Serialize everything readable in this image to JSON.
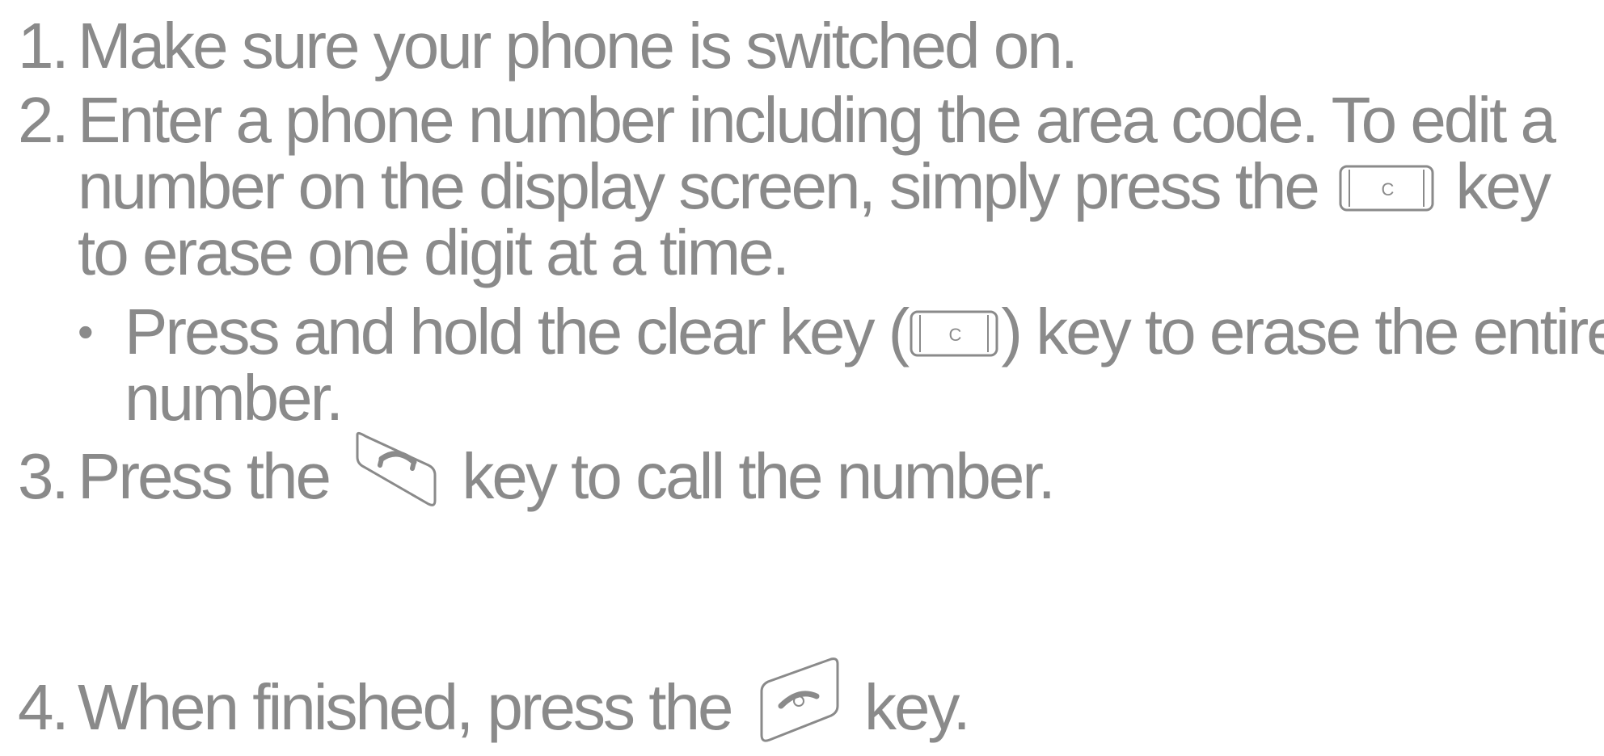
{
  "steps": [
    {
      "number": "1.",
      "lines": [
        "Make sure your phone is switched on."
      ]
    },
    {
      "number": "2.",
      "line1": "Enter a phone number including the area code. To edit a",
      "line2_before": "number on the display screen, simply press the",
      "line2_after": "key",
      "line3": "to erase one digit at a time.",
      "sub": {
        "bullet": "•",
        "line1_before": "Press and hold the clear key (",
        "line1_after": ") key to erase the entire",
        "line2": "number."
      }
    },
    {
      "number": "3.",
      "before": "Press the",
      "after": "key to call the number."
    },
    {
      "number": "4.",
      "before": "When finished, press the",
      "after": "key."
    }
  ],
  "icons": {
    "clear_key_label": "C",
    "clear_key": "clear-key-icon",
    "send_key": "send-key-icon",
    "end_key": "end-key-icon"
  },
  "colors": {
    "text": "#8a8a8a"
  }
}
